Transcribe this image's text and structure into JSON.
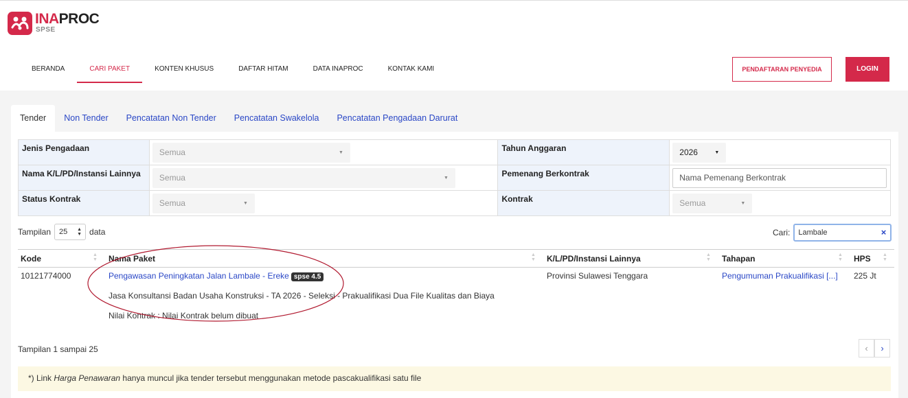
{
  "brand": {
    "ina": "INA",
    "proc": "PROC",
    "sub": "SPSE"
  },
  "nav": [
    {
      "label": "BERANDA",
      "active": false
    },
    {
      "label": "CARI PAKET",
      "active": true
    },
    {
      "label": "KONTEN KHUSUS",
      "active": false
    },
    {
      "label": "DAFTAR HITAM",
      "active": false
    },
    {
      "label": "DATA INAPROC",
      "active": false
    },
    {
      "label": "KONTAK KAMI",
      "active": false
    }
  ],
  "header_buttons": {
    "register": "PENDAFTARAN PENYEDIA",
    "login": "LOGIN"
  },
  "tabs": [
    {
      "label": "Tender",
      "active": true
    },
    {
      "label": "Non Tender",
      "active": false
    },
    {
      "label": "Pencatatan Non Tender",
      "active": false
    },
    {
      "label": "Pencatatan Swakelola",
      "active": false
    },
    {
      "label": "Pencatatan Pengadaan Darurat",
      "active": false
    }
  ],
  "filters": {
    "jenis_label": "Jenis Pengadaan",
    "jenis_value": "Semua",
    "tahun_label": "Tahun Anggaran",
    "tahun_value": "2026",
    "instansi_label": "Nama K/L/PD/Instansi Lainnya",
    "instansi_value": "Semua",
    "pemenang_label": "Pemenang Berkontrak",
    "pemenang_placeholder": "Nama Pemenang Berkontrak",
    "status_label": "Status Kontrak",
    "status_value": "Semua",
    "kontrak_label": "Kontrak",
    "kontrak_value": "Semua"
  },
  "listing": {
    "show_label": "Tampilan",
    "page_size": "25",
    "data_label": "data",
    "search_label": "Cari:",
    "search_value": "Lambale",
    "clear_icon": "×"
  },
  "columns": {
    "kode": "Kode",
    "nama": "Nama Paket",
    "instansi": "K/L/PD/Instansi Lainnya",
    "tahapan": "Tahapan",
    "hps": "HPS"
  },
  "rows": [
    {
      "kode": "10121774000",
      "nama": "Pengawasan Peningkatan Jalan Lambale - Ereke",
      "badge": "spse 4.5",
      "detail": "Jasa Konsultansi Badan Usaha Konstruksi - TA 2026 - Seleksi - Prakualifikasi Dua File Kualitas dan Biaya",
      "nilai": "Nilai Kontrak : Nilai Kontrak belum dibuat",
      "instansi": "Provinsi Sulawesi Tenggara",
      "tahapan": "Pengumuman Prakualifikasi [...]",
      "hps": "225 Jt"
    }
  ],
  "footer": {
    "info": "Tampilan 1 sampai 25",
    "prev": "‹",
    "next": "›"
  },
  "note": {
    "prefix": "*) Link ",
    "em": "Harga Penawaran",
    "suffix": " hanya muncul jika tender tersebut menggunakan metode pascakualifikasi satu file"
  },
  "colors": {
    "brand": "#d4294a",
    "link": "#2a47c6",
    "annotation": "#b0182e"
  }
}
